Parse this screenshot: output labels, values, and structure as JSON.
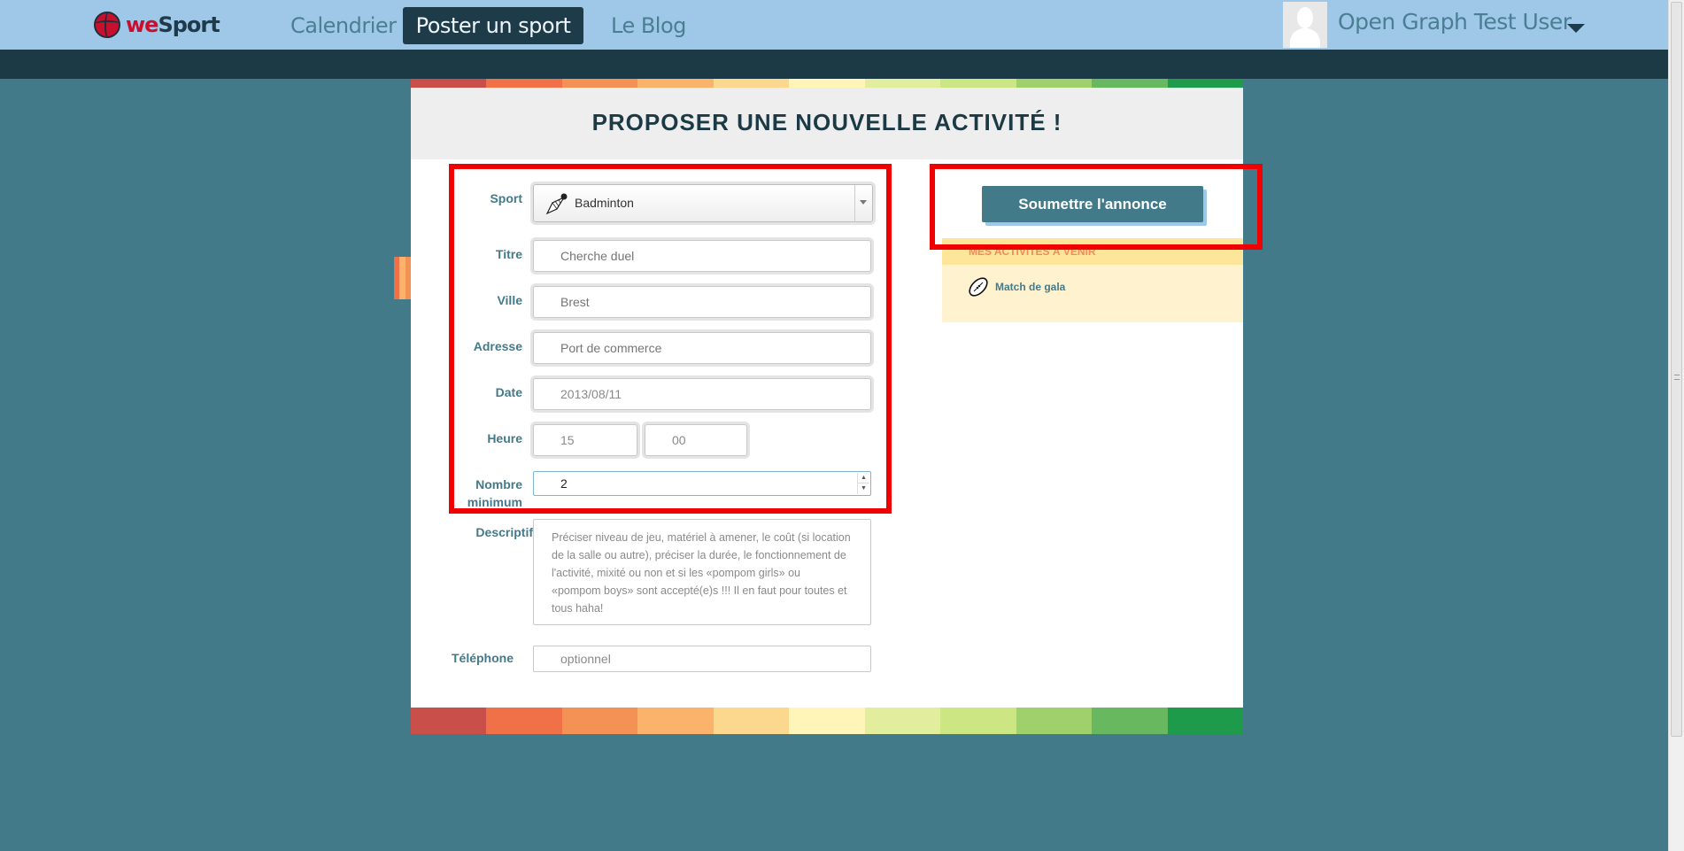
{
  "nav": {
    "logo_we": "we",
    "logo_sport": "Sport",
    "calendar": "Calendrier",
    "post": "Poster un sport",
    "blog": "Le Blog",
    "user_name": "Open Graph Test User"
  },
  "page_title": "PROPOSER UNE NOUVELLE ACTIVITÉ !",
  "form": {
    "sport_label": "Sport",
    "sport_value": "Badminton",
    "titre_label": "Titre",
    "titre_placeholder": "Cherche duel",
    "ville_label": "Ville",
    "ville_placeholder": "Brest",
    "adresse_label": "Adresse",
    "adresse_placeholder": "Port de commerce",
    "date_label": "Date",
    "date_value": "2013/08/11",
    "heure_label": "Heure",
    "heure_hours": "15",
    "heure_minutes": "00",
    "nombre_label_1": "Nombre",
    "nombre_label_2": "minimum",
    "nombre_value": "2",
    "descriptif_label": "Descriptif",
    "descriptif_placeholder": "Préciser niveau de jeu, matériel à amener, le coût (si location de la salle ou autre), préciser la durée, le fonctionnement de l'activité, mixité ou non et si les «pompom girls» ou «pompom boys» sont accepté(e)s !!! Il en faut pour toutes et tous haha!",
    "telephone_label": "Téléphone",
    "telephone_placeholder": "optionnel"
  },
  "submit_label": "Soumettre l'annonce",
  "upcoming": {
    "title": "Mes activités à venir",
    "items": [
      {
        "label": "Match de gala",
        "icon": "rugby-ball-icon"
      }
    ]
  },
  "colors": {
    "nav_bg": "#9ec7e8",
    "dark_bar": "#1c3a45",
    "page_bg": "#437a8a",
    "highlight": "#f00000",
    "stripe": [
      "#c9504a",
      "#f07048",
      "#f49255",
      "#fbb36c",
      "#fcd88f",
      "#fff5b8",
      "#e2ee9e",
      "#cbe683",
      "#9fd06c",
      "#67b85f",
      "#1d9a4a"
    ]
  }
}
